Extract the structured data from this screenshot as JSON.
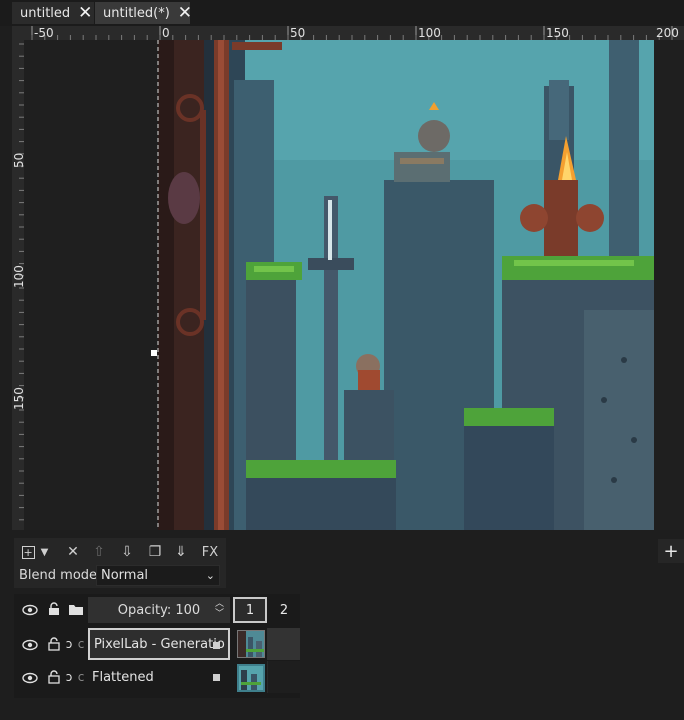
{
  "tabs": [
    {
      "label": "untitled",
      "close": "✕"
    },
    {
      "label": "untitled(*)",
      "close": "✕"
    }
  ],
  "ruler": {
    "h_labels": [
      "-50",
      "0",
      "50",
      "100",
      "150",
      "200"
    ],
    "v_labels": [
      "50",
      "100",
      "150"
    ]
  },
  "toolbar": {
    "add": "+",
    "delete": "✕",
    "move_up": "⇧",
    "move_down": "⇩",
    "duplicate": "❐",
    "merge_down": "⇓",
    "fx": "FX",
    "new_panel": "+"
  },
  "blend": {
    "label": "Blend mode:",
    "value": "Normal"
  },
  "layers_panel": {
    "opacity_label": "Opacity: 100",
    "frames": [
      "1",
      "2"
    ],
    "layers": [
      {
        "name": "PixelLab - Generatio",
        "selected": true
      },
      {
        "name": "Flattened",
        "selected": false
      }
    ]
  },
  "colors": {
    "accent": "#c9c9c9",
    "sky": "#4f9aa3",
    "rust": "#7a3b2a",
    "moss": "#4ea33a"
  }
}
